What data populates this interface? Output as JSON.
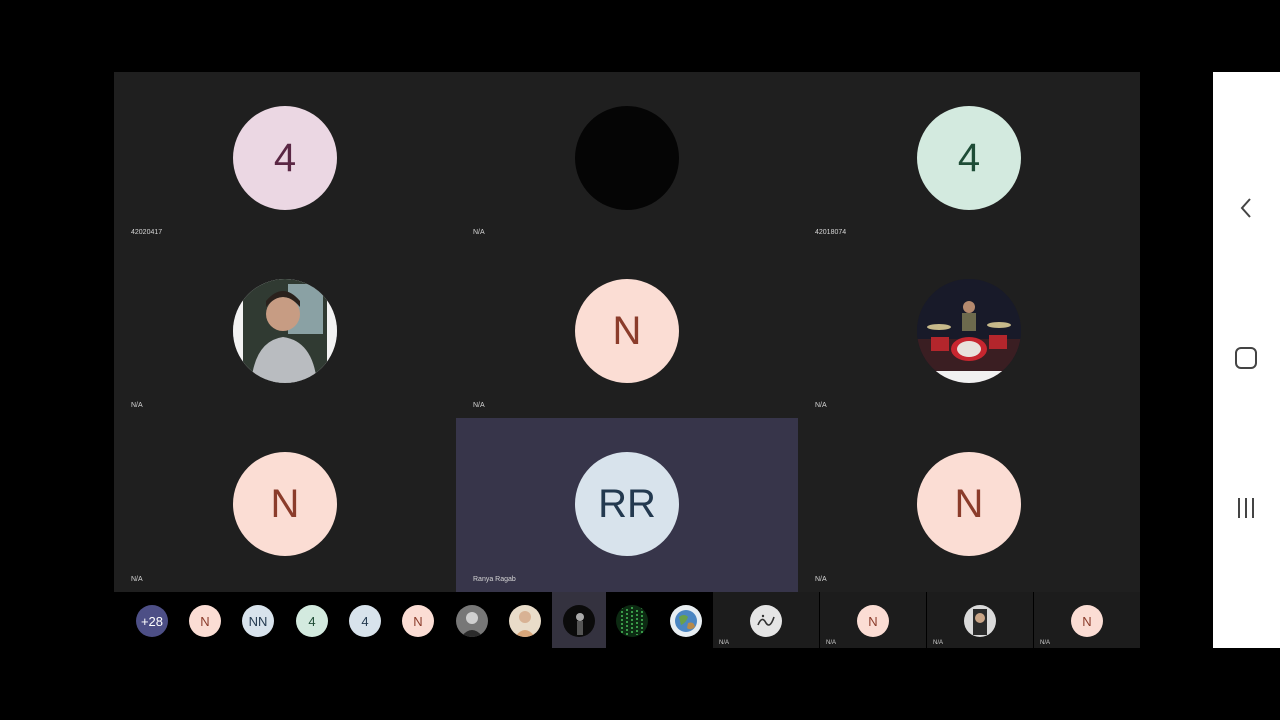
{
  "tiles": [
    {
      "name": "42020417",
      "initials": "4",
      "bg": "#ebd7e3",
      "fg": "#5a2744",
      "kind": "initials"
    },
    {
      "name": "N/A",
      "initials": "",
      "bg": "#050505",
      "fg": "#050505",
      "kind": "dark-photo"
    },
    {
      "name": "42018074",
      "initials": "4",
      "bg": "#d3eadf",
      "fg": "#1e4c36",
      "kind": "initials"
    },
    {
      "name": "N/A",
      "initials": "",
      "bg": "#8a8f96",
      "fg": "#ffffff",
      "kind": "person-photo"
    },
    {
      "name": "N/A",
      "initials": "N",
      "bg": "#fbddd4",
      "fg": "#8b3c2b",
      "kind": "initials"
    },
    {
      "name": "N/A",
      "initials": "",
      "bg": "#1a1a2a",
      "fg": "#ffffff",
      "kind": "drums-photo"
    },
    {
      "name": "N/A",
      "initials": "N",
      "bg": "#fbddd4",
      "fg": "#8b3c2b",
      "kind": "initials"
    },
    {
      "name": "Ranya Ragab",
      "initials": "RR",
      "bg": "#d8e3ec",
      "fg": "#23394f",
      "kind": "initials"
    },
    {
      "name": "N/A",
      "initials": "N",
      "bg": "#fbddd4",
      "fg": "#8b3c2b",
      "kind": "initials"
    }
  ],
  "strip": {
    "overflow": {
      "label": "+28",
      "bg": "#4d4f86",
      "fg": "#ffffff"
    },
    "chips": [
      {
        "label": "N",
        "bg": "#fbddd4",
        "fg": "#8b3c2b",
        "icon": "initials"
      },
      {
        "label": "NN",
        "bg": "#d8e3ec",
        "fg": "#23394f",
        "icon": "initials"
      },
      {
        "label": "4",
        "bg": "#d3eadf",
        "fg": "#1e4c36",
        "icon": "initials"
      },
      {
        "label": "4",
        "bg": "#d8e3ec",
        "fg": "#23394f",
        "icon": "initials"
      },
      {
        "label": "N",
        "bg": "#fbddd4",
        "fg": "#8b3c2b",
        "icon": "initials"
      },
      {
        "label": "",
        "bg": "#777777",
        "fg": "#ffffff",
        "icon": "person-photo-icon"
      },
      {
        "label": "",
        "bg": "#e9dcc9",
        "fg": "#ffffff",
        "icon": "person-photo-icon"
      },
      {
        "label": "",
        "bg": "#0b0b0b",
        "fg": "#ffffff",
        "icon": "person-photo-icon"
      },
      {
        "label": "",
        "bg": "#0c2a12",
        "fg": "#48c05a",
        "icon": "matrix-photo-icon"
      },
      {
        "label": "",
        "bg": "#e8eef2",
        "fg": "#4f7f3d",
        "icon": "globe-photo-icon"
      }
    ],
    "named": [
      {
        "name": "N/A",
        "label": "",
        "bg": "#e5e5e5",
        "fg": "#333333",
        "icon": "calligraphy-photo-icon"
      },
      {
        "name": "N/A",
        "label": "N",
        "bg": "#fbddd4",
        "fg": "#8b3c2b",
        "icon": "initials"
      },
      {
        "name": "N/A",
        "label": "",
        "bg": "#dadada",
        "fg": "#222222",
        "icon": "person-photo-icon"
      },
      {
        "name": "N/A",
        "label": "N",
        "bg": "#fbddd4",
        "fg": "#8b3c2b",
        "icon": "initials"
      }
    ]
  },
  "android_nav": {
    "back": "back-icon",
    "home": "home-icon",
    "recents": "recents-icon"
  }
}
